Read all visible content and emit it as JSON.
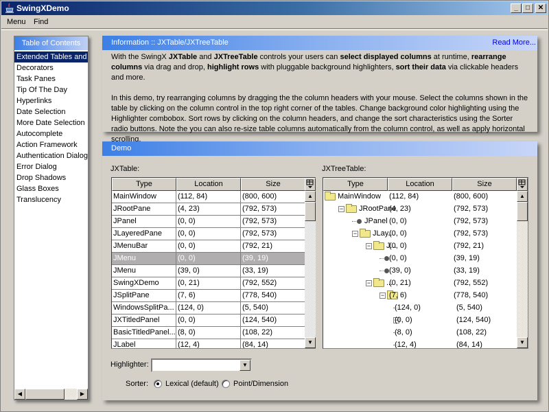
{
  "window": {
    "title": "SwingXDemo",
    "controls": {
      "minimize": "_",
      "maximize": "□",
      "close": "✕"
    }
  },
  "menubar": {
    "items": [
      "Menu",
      "Find"
    ]
  },
  "toc": {
    "title": "Table of Contents",
    "items": [
      "Extended Tables and",
      "Decorators",
      "Task Panes",
      "Tip Of The Day",
      "Hyperlinks",
      "Date Selection",
      "More Date Selection",
      "Autocomplete",
      "Action Framework",
      "Authentication Dialogs",
      "Error Dialog",
      "Drop Shadows",
      "Glass Boxes",
      "Translucency"
    ],
    "selected_index": 0
  },
  "info": {
    "title": "Information :: JXTable/JXTreeTable",
    "read_more": "Read More...",
    "para1": [
      {
        "t": "With the SwingX ",
        "b": false
      },
      {
        "t": "JXTable",
        "b": true
      },
      {
        "t": " and ",
        "b": false
      },
      {
        "t": "JXTreeTable",
        "b": true
      },
      {
        "t": " controls your users can ",
        "b": false
      },
      {
        "t": "select displayed columns",
        "b": true
      },
      {
        "t": " at runtime, ",
        "b": false
      },
      {
        "t": "rearrange columns",
        "b": true
      },
      {
        "t": " via drag and drop, ",
        "b": false
      },
      {
        "t": "highlight rows",
        "b": true
      },
      {
        "t": " with pluggable background highlighters, ",
        "b": false
      },
      {
        "t": "sort their data",
        "b": true
      },
      {
        "t": " via clickable headers and more.",
        "b": false
      }
    ],
    "para2": "In this demo, try rearranging columns by dragging the the column headers with your mouse. Select the columns shown in the table by clicking on the column control in the top right corner of the tables. Change background color highlighting using the Highlighter combobox. Sort rows by clicking on the column headers, and change the sort characteristics using the Sorter radio buttons. Note the you can also re-size table columns automatically from the column control, as well as apply horizontal scrolling."
  },
  "demo": {
    "title": "Demo",
    "jxtable": {
      "label": "JXTable:",
      "columns": [
        "Type",
        "Location",
        "Size"
      ],
      "selected_row": 5,
      "rows": [
        [
          "MainWindow",
          "(112, 84)",
          "(800, 600)"
        ],
        [
          "JRootPane",
          "(4, 23)",
          "(792, 573)"
        ],
        [
          "JPanel",
          "(0, 0)",
          "(792, 573)"
        ],
        [
          "JLayeredPane",
          "(0, 0)",
          "(792, 573)"
        ],
        [
          "JMenuBar",
          "(0, 0)",
          "(792, 21)"
        ],
        [
          "JMenu",
          "(0, 0)",
          "(39, 19)"
        ],
        [
          "JMenu",
          "(39, 0)",
          "(33, 19)"
        ],
        [
          "SwingXDemo",
          "(0, 21)",
          "(792, 552)"
        ],
        [
          "JSplitPane",
          "(7, 6)",
          "(778, 540)"
        ],
        [
          "WindowsSplitPa...",
          "(124, 0)",
          "(5, 540)"
        ],
        [
          "JXTitledPanel",
          "(0, 0)",
          "(124, 540)"
        ],
        [
          "BasicTitledPanel...",
          "(8, 0)",
          "(108, 22)"
        ],
        [
          "JLabel",
          "(12, 4)",
          "(84, 14)"
        ]
      ]
    },
    "jxtreetable": {
      "label": "JXTreeTable:",
      "columns": [
        "Type",
        "Location",
        "Size"
      ],
      "rows": [
        {
          "name": "MainWindow",
          "loc": "(112, 84)",
          "size": "(800, 600)",
          "depth": 0,
          "kind": "folder",
          "expander": false
        },
        {
          "name": "JRootPane",
          "loc": "(4, 23)",
          "size": "(792, 573)",
          "depth": 1,
          "kind": "folder",
          "expander": true
        },
        {
          "name": "JPanel",
          "loc": "(0, 0)",
          "size": "(792, 573)",
          "depth": 2,
          "kind": "leaf",
          "expander": false
        },
        {
          "name": "JLay...",
          "loc": "(0, 0)",
          "size": "(792, 573)",
          "depth": 2,
          "kind": "folder",
          "expander": true
        },
        {
          "name": "J...",
          "loc": "(0, 0)",
          "size": "(792, 21)",
          "depth": 3,
          "kind": "folder",
          "expander": true
        },
        {
          "name": "",
          "loc": "(0, 0)",
          "size": "(39, 19)",
          "depth": 4,
          "kind": "leaf",
          "expander": false
        },
        {
          "name": "",
          "loc": "(39, 0)",
          "size": "(33, 19)",
          "depth": 4,
          "kind": "leaf",
          "expander": false
        },
        {
          "name": "...",
          "loc": "(0, 21)",
          "size": "(792, 552)",
          "depth": 3,
          "kind": "folder",
          "expander": true
        },
        {
          "name": "",
          "loc": "(7, 6)",
          "size": "(778, 540)",
          "depth": 4,
          "kind": "folder",
          "expander": true
        },
        {
          "name": "",
          "loc": "(124, 0)",
          "size": "(5, 540)",
          "depth": 5,
          "kind": "none",
          "expander": false
        },
        {
          "name": "",
          "loc": "(0, 0)",
          "size": "(124, 540)",
          "depth": 5,
          "kind": "none",
          "expander": true
        },
        {
          "name": "",
          "loc": "(8, 0)",
          "size": "(108, 22)",
          "depth": 5,
          "kind": "none",
          "expander": false
        },
        {
          "name": "",
          "loc": "(12, 4)",
          "size": "(84, 14)",
          "depth": 5,
          "kind": "none",
          "expander": false
        }
      ]
    },
    "highlighter": {
      "label": "Highlighter:",
      "value": ""
    },
    "sorter": {
      "label": "Sorter:",
      "options": [
        "Lexical (default)",
        "Point/Dimension"
      ],
      "selected": 0
    }
  }
}
